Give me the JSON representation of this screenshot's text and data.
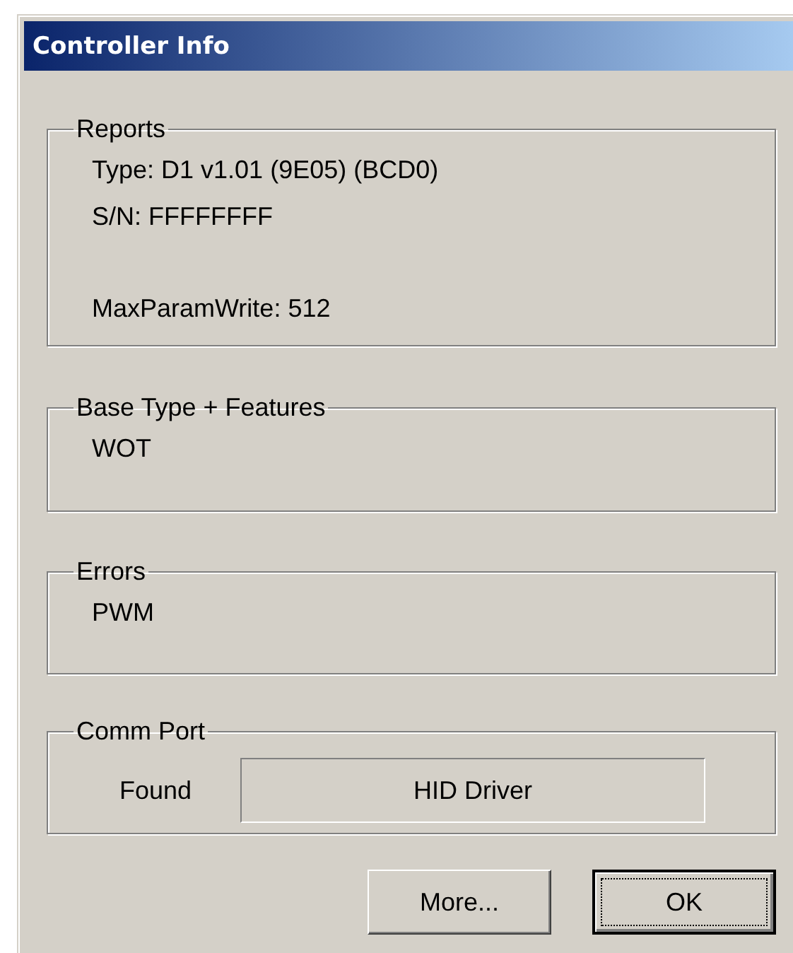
{
  "window": {
    "title": "Controller Info"
  },
  "groups": [
    {
      "kind": "text",
      "legend": "Reports",
      "paragraphs": [
        [
          "Type: D1 v1.01 (9E05) (BCD0)",
          "S/N: FFFFFFFF"
        ],
        [
          "MaxParamWrite: 512"
        ]
      ]
    },
    {
      "kind": "text",
      "legend": "Base Type + Features",
      "paragraphs": [
        [
          "WOT"
        ]
      ]
    },
    {
      "kind": "text",
      "legend": "Errors",
      "paragraphs": [
        [
          "PWM"
        ]
      ]
    },
    {
      "kind": "field",
      "legend": "Comm Port",
      "label": "Found",
      "value": "HID Driver"
    }
  ],
  "buttons": [
    {
      "label": "More...",
      "default": false
    },
    {
      "label": "OK",
      "default": true
    }
  ]
}
